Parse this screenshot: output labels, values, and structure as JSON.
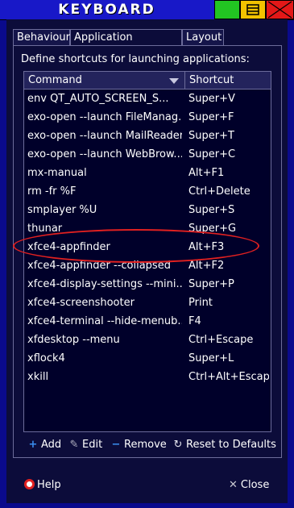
{
  "window": {
    "title": "KEYBOARD",
    "buttons": [
      "minimize-icon",
      "maximize-icon",
      "close-icon"
    ],
    "colors": {
      "titlebar": "#1818c8",
      "minimize": "#22c522",
      "maximize": "#f2c200",
      "close": "#e31818",
      "background": "#0c0c3a"
    }
  },
  "tabs": [
    {
      "label": "Behaviour",
      "active": false
    },
    {
      "label": "Application Shortcuts",
      "active": true
    },
    {
      "label": "Layout",
      "active": false
    }
  ],
  "description": "Define shortcuts for launching applications:",
  "table": {
    "headers": {
      "command": "Command",
      "shortcut": "Shortcut"
    },
    "rows": [
      {
        "command": "env QT_AUTO_SCREEN_S...",
        "shortcut": "Super+V"
      },
      {
        "command": "exo-open --launch FileManag...",
        "shortcut": "Super+F"
      },
      {
        "command": "exo-open --launch MailReader",
        "shortcut": "Super+T"
      },
      {
        "command": "exo-open --launch WebBrow...",
        "shortcut": "Super+C"
      },
      {
        "command": "mx-manual",
        "shortcut": "Alt+F1"
      },
      {
        "command": "rm -fr %F",
        "shortcut": "Ctrl+Delete"
      },
      {
        "command": "smplayer %U",
        "shortcut": "Super+S"
      },
      {
        "command": "thunar",
        "shortcut": "Super+G"
      },
      {
        "command": "xfce4-appfinder",
        "shortcut": "Alt+F3"
      },
      {
        "command": "xfce4-appfinder --collapsed",
        "shortcut": "Alt+F2"
      },
      {
        "command": "xfce4-display-settings --mini...",
        "shortcut": "Super+P"
      },
      {
        "command": "xfce4-screenshooter",
        "shortcut": "Print"
      },
      {
        "command": "xfce4-terminal --hide-menub...",
        "shortcut": "F4"
      },
      {
        "command": "xfdesktop --menu",
        "shortcut": "Ctrl+Escape"
      },
      {
        "command": "xflock4",
        "shortcut": "Super+L"
      },
      {
        "command": "xkill",
        "shortcut": "Ctrl+Alt+Escape"
      }
    ]
  },
  "actions": {
    "add": "Add",
    "edit": "Edit",
    "remove": "Remove",
    "reset": "Reset to Defaults"
  },
  "footer": {
    "help": "Help",
    "close": "Close"
  }
}
